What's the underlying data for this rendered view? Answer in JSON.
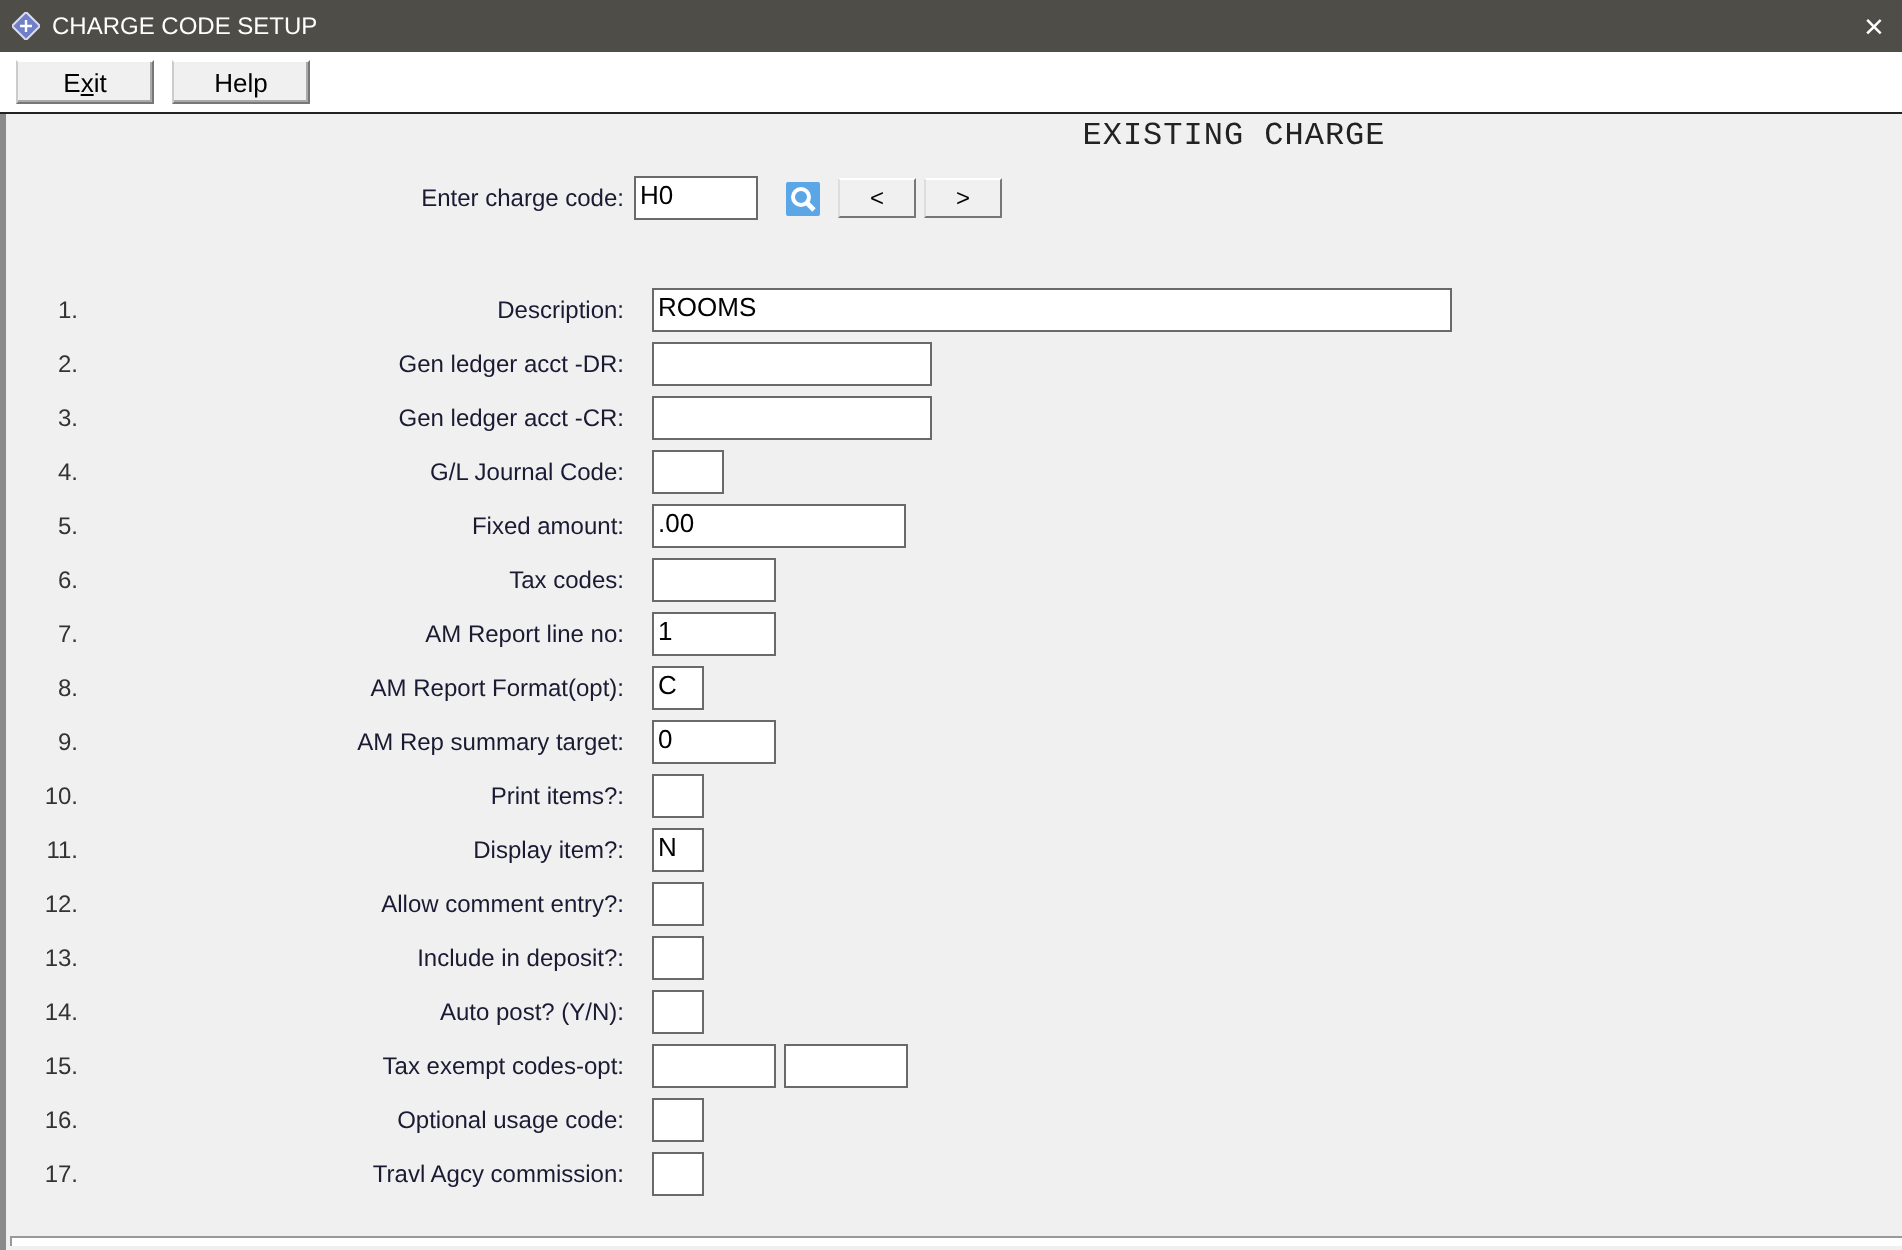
{
  "window": {
    "title": "CHARGE CODE SETUP",
    "close": "×"
  },
  "toolbar": [
    {
      "label_parts": [
        {
          "text": "E",
          "underlined": false
        },
        {
          "text": "x",
          "underlined": true
        },
        {
          "text": "it",
          "underlined": false
        }
      ]
    },
    {
      "label_parts": [
        {
          "text": "Help",
          "underlined": false
        }
      ]
    }
  ],
  "heading": "EXISTING CHARGE",
  "charge_code": {
    "label": "Enter charge code:",
    "value": "H0",
    "nav": [
      "<",
      ">"
    ]
  },
  "rows": [
    {
      "number": "1.",
      "label": "Description:",
      "fields": [
        {
          "kind": "wide",
          "value": "ROOMS"
        }
      ]
    },
    {
      "number": "2.",
      "label": "Gen ledger acct -DR:",
      "fields": [
        {
          "kind": "large"
        }
      ]
    },
    {
      "number": "3.",
      "label": "Gen ledger acct -CR:",
      "fields": [
        {
          "kind": "large"
        }
      ]
    },
    {
      "number": "4.",
      "label": "G/L Journal Code:",
      "fields": [
        {
          "kind": "mini"
        }
      ]
    },
    {
      "number": "5.",
      "label": "Fixed amount:",
      "fields": [
        {
          "kind": "medium",
          "value": ".00"
        }
      ]
    },
    {
      "number": "6.",
      "label": "Tax codes:",
      "fields": [
        {
          "kind": "small"
        }
      ]
    },
    {
      "number": "7.",
      "label": "AM Report line no:",
      "fields": [
        {
          "kind": "small",
          "value": "1"
        }
      ]
    },
    {
      "number": "8.",
      "label": "AM Report Format(opt):",
      "fields": [
        {
          "kind": "tiny",
          "value": "C"
        }
      ]
    },
    {
      "number": "9.",
      "label": "AM Rep summary target:",
      "fields": [
        {
          "kind": "small",
          "value": "0"
        }
      ]
    },
    {
      "number": "10.",
      "label": "Print items?:",
      "fields": [
        {
          "kind": "tiny"
        }
      ]
    },
    {
      "number": "11.",
      "label": "Display item?:",
      "fields": [
        {
          "kind": "tiny",
          "value": "N"
        }
      ]
    },
    {
      "number": "12.",
      "label": "Allow comment entry?:",
      "fields": [
        {
          "kind": "tiny"
        }
      ]
    },
    {
      "number": "13.",
      "label": "Include in deposit?:",
      "fields": [
        {
          "kind": "tiny"
        }
      ]
    },
    {
      "number": "14.",
      "label": "Auto post? (Y/N):",
      "fields": [
        {
          "kind": "tiny"
        }
      ]
    },
    {
      "number": "15.",
      "label": "Tax exempt codes-opt:",
      "fields": [
        {
          "kind": "small"
        },
        {
          "kind": "small"
        }
      ]
    },
    {
      "number": "16.",
      "label": "Optional usage code:",
      "fields": [
        {
          "kind": "tiny"
        }
      ]
    },
    {
      "number": "17.",
      "label": "Travl Agcy commission:",
      "fields": [
        {
          "kind": "tiny"
        }
      ]
    }
  ]
}
